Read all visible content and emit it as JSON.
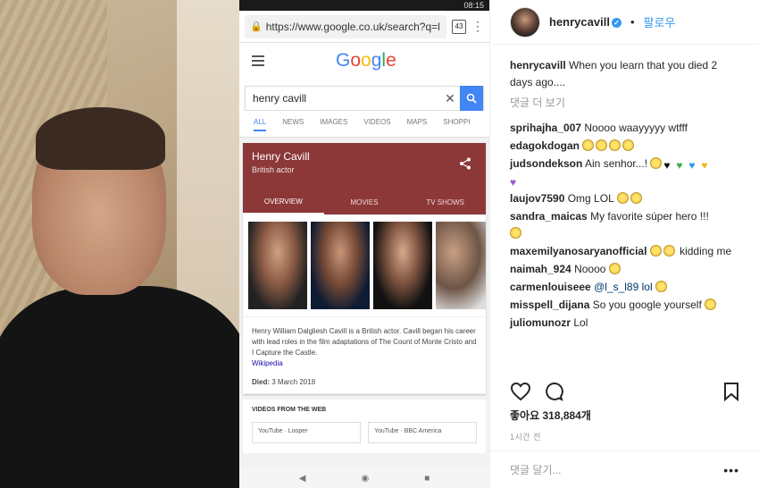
{
  "phone": {
    "status_time": "08:15",
    "url": "https://www.google.co.uk/search?q=l",
    "tab_count": "43",
    "logo": "Google",
    "query": "henry cavill",
    "tabs": [
      "ALL",
      "NEWS",
      "IMAGES",
      "VIDEOS",
      "MAPS",
      "SHOPPI"
    ],
    "panel": {
      "name": "Henry Cavill",
      "subtitle": "British actor",
      "tabs": [
        "OVERVIEW",
        "MOVIES",
        "TV SHOWS"
      ],
      "description": "Henry William Dalgliesh Cavill is a British actor. Cavill began his career with lead roles in the film adaptations of The Count of Monte Cristo and I Capture the Castle.",
      "source_link": "Wikipedia",
      "died_label": "Died:",
      "died_value": "3 March 2018"
    },
    "videos_heading": "VIDEOS FROM THE WEB",
    "video_cards": [
      "YouTube · Looper",
      "YouTube · BBC America"
    ]
  },
  "instagram": {
    "username": "henrycavill",
    "follow_label": "팔로우",
    "caption_user": "henrycavill",
    "caption_text": "When you learn that you died 2 days ago....",
    "more_comments": "댓글 더 보기",
    "comments": [
      {
        "user": "sprihajha_007",
        "text": "Noooo waayyyyy wtfff"
      },
      {
        "user": "edagokdogan",
        "text": ""
      },
      {
        "user": "judsondekson",
        "text": "Ain senhor...!"
      },
      {
        "user": "laujov7590",
        "text": "Omg LOL"
      },
      {
        "user": "sandra_maicas",
        "text": "My favorite súper hero !!!"
      },
      {
        "user": "maxemilyanosaryanofficial",
        "text": "kidding me"
      },
      {
        "user": "naimah_924",
        "text": "Noooo"
      },
      {
        "user": "carmenlouiseee",
        "text": "@l_s_l89 lol"
      },
      {
        "user": "misspell_dijana",
        "text": "So you google yourself"
      },
      {
        "user": "juliomunozr",
        "text": "Lol"
      }
    ],
    "likes_label": "좋아요",
    "likes_count": "318,884개",
    "time_ago": "1시간 전",
    "add_comment_placeholder": "댓글 달기...",
    "options": "•••",
    "colors": {
      "link": "#3897f0",
      "panel": "#8c3838",
      "google_blue": "#4285f4"
    }
  }
}
